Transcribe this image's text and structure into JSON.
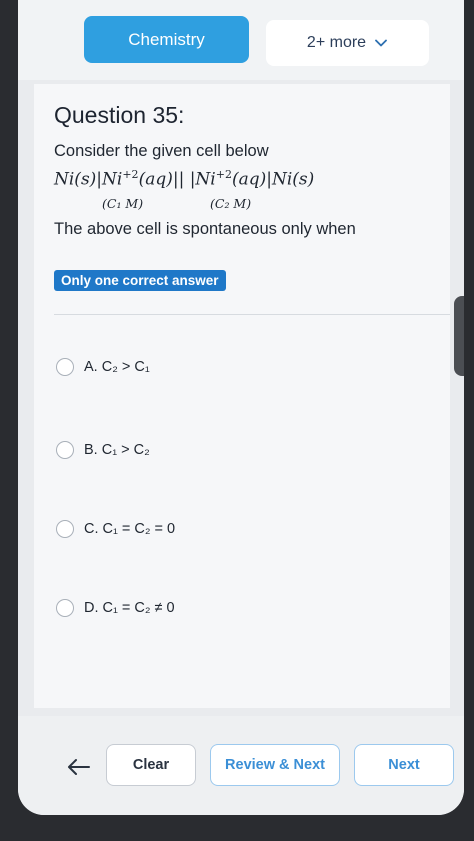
{
  "header": {
    "subject_tab": "Chemistry",
    "more_tab": "2+ more"
  },
  "question": {
    "title": "Question 35:",
    "intro": "Consider the given cell below",
    "cell_left": "Ni(s)|Ni",
    "cell_sup1": "+2",
    "cell_mid": "(aq)|| |Ni",
    "cell_sup2": "+2",
    "cell_right": "(aq)|Ni(s)",
    "conc_left": "(C₁  M)",
    "conc_right": "(C₂  M)",
    "prompt": "The above cell is spontaneous only when",
    "answer_type": "Only one correct answer"
  },
  "options": [
    {
      "label": "A. C₂ > C₁"
    },
    {
      "label": "B. C₁ > C₂"
    },
    {
      "label": "C. C₁ = C₂ = 0"
    },
    {
      "label": "D. C₁ = C₂ ≠ 0"
    }
  ],
  "footer": {
    "clear_label": "Clear",
    "review_next_label": "Review & Next",
    "next_label": "Next"
  },
  "colors": {
    "accent": "#2f9fe0",
    "badge": "#1f78c8",
    "link": "#3b8fd6"
  }
}
